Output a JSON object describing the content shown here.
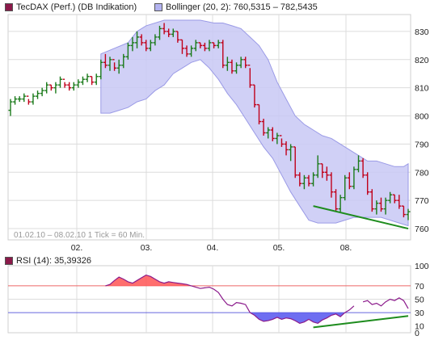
{
  "legend": {
    "main": {
      "label": "TecDAX (Perf.) (DB Indikation)",
      "color": "#8b1a4a"
    },
    "bollinger": {
      "label": "Bollinger (20, 2): 760,5315 – 782,5435",
      "color": "#b3b3f0"
    },
    "rsi": {
      "label": "RSI (14): 35,39326",
      "color": "#8b1a4a"
    }
  },
  "info": "01.02.10 – 08.02.10   1 Tick = 60 Min.",
  "colors": {
    "up": "#1a7a1a",
    "down": "#c0001a",
    "band_fill": "#c8c8f4",
    "band_stroke": "#9a9ae6",
    "trend": "#1e8c1e",
    "rsi_line": "#8b1a8b",
    "rsi_over": "#ff5555",
    "rsi_under": "#5555ee",
    "grid": "#dcdcdc",
    "line70": "#ee6666",
    "line30": "#6666dd"
  },
  "chart_data": [
    {
      "type": "candlestick",
      "title": "TecDAX (Perf.) (DB Indikation)",
      "x_ticks": [
        "02.",
        "03.",
        "04.",
        "05.",
        "08."
      ],
      "ylim": [
        756,
        836
      ],
      "y_ticks": [
        760,
        770,
        780,
        790,
        800,
        810,
        820,
        830
      ],
      "bars_ohlc": [
        [
          802,
          806,
          800,
          805
        ],
        [
          805,
          807,
          804,
          806
        ],
        [
          806,
          807,
          805,
          806
        ],
        [
          806,
          808,
          805,
          807
        ],
        [
          807,
          806,
          804,
          805
        ],
        [
          805,
          808,
          804,
          807
        ],
        [
          807,
          809,
          806,
          808
        ],
        [
          808,
          810,
          807,
          809
        ],
        [
          809,
          812,
          808,
          811
        ],
        [
          811,
          811,
          809,
          810
        ],
        [
          810,
          812,
          808,
          811
        ],
        [
          811,
          814,
          810,
          813
        ],
        [
          813,
          812,
          810,
          811
        ],
        [
          811,
          812,
          809,
          810
        ],
        [
          810,
          812,
          809,
          811
        ],
        [
          811,
          813,
          810,
          812
        ],
        [
          812,
          814,
          811,
          813
        ],
        [
          813,
          815,
          812,
          814
        ],
        [
          814,
          814,
          811,
          812
        ],
        [
          812,
          815,
          811,
          814
        ],
        [
          814,
          820,
          813,
          819
        ],
        [
          819,
          822,
          817,
          818
        ],
        [
          818,
          821,
          816,
          820
        ],
        [
          820,
          819,
          816,
          817
        ],
        [
          817,
          820,
          815,
          818
        ],
        [
          818,
          822,
          817,
          821
        ],
        [
          821,
          826,
          820,
          825
        ],
        [
          825,
          828,
          823,
          826
        ],
        [
          826,
          830,
          824,
          828
        ],
        [
          828,
          829,
          825,
          826
        ],
        [
          826,
          827,
          823,
          824
        ],
        [
          824,
          827,
          823,
          826
        ],
        [
          826,
          829,
          825,
          828
        ],
        [
          828,
          832,
          827,
          831
        ],
        [
          831,
          833,
          829,
          830
        ],
        [
          830,
          831,
          828,
          829
        ],
        [
          829,
          831,
          828,
          830
        ],
        [
          830,
          830,
          826,
          827
        ],
        [
          827,
          827,
          822,
          824
        ],
        [
          824,
          825,
          821,
          822
        ],
        [
          822,
          825,
          821,
          824
        ],
        [
          824,
          827,
          823,
          826
        ],
        [
          826,
          826,
          824,
          825
        ],
        [
          825,
          826,
          823,
          824
        ],
        [
          824,
          827,
          823,
          826
        ],
        [
          826,
          826,
          824,
          825
        ],
        [
          825,
          827,
          824,
          826
        ],
        [
          826,
          827,
          817,
          818
        ],
        [
          818,
          821,
          816,
          819
        ],
        [
          819,
          820,
          815,
          816
        ],
        [
          816,
          819,
          815,
          818
        ],
        [
          818,
          821,
          817,
          820
        ],
        [
          820,
          821,
          817,
          818
        ],
        [
          818,
          817,
          810,
          811
        ],
        [
          811,
          811,
          803,
          804
        ],
        [
          804,
          804,
          797,
          798
        ],
        [
          798,
          799,
          793,
          794
        ],
        [
          794,
          796,
          792,
          795
        ],
        [
          795,
          796,
          791,
          792
        ],
        [
          792,
          794,
          790,
          793
        ],
        [
          793,
          792,
          789,
          790
        ],
        [
          790,
          791,
          786,
          788
        ],
        [
          788,
          790,
          784,
          789
        ],
        [
          789,
          789,
          778,
          779
        ],
        [
          779,
          780,
          775,
          776
        ],
        [
          776,
          779,
          774,
          778
        ],
        [
          778,
          779,
          775,
          776
        ],
        [
          776,
          780,
          775,
          779
        ],
        [
          779,
          786,
          778,
          783
        ],
        [
          783,
          783,
          778,
          780
        ],
        [
          780,
          782,
          777,
          779
        ],
        [
          779,
          780,
          771,
          773
        ],
        [
          773,
          774,
          766,
          767
        ],
        [
          767,
          772,
          766,
          771
        ],
        [
          771,
          779,
          770,
          778
        ],
        [
          778,
          780,
          774,
          775
        ],
        [
          775,
          782,
          774,
          781
        ],
        [
          781,
          786,
          780,
          784
        ],
        [
          784,
          785,
          778,
          779
        ],
        [
          779,
          780,
          772,
          773
        ],
        [
          773,
          774,
          766,
          767
        ],
        [
          767,
          770,
          765,
          769
        ],
        [
          769,
          771,
          766,
          767
        ],
        [
          767,
          771,
          765,
          770
        ],
        [
          770,
          773,
          769,
          772
        ],
        [
          772,
          772,
          769,
          770
        ],
        [
          770,
          772,
          767,
          768
        ],
        [
          768,
          768,
          764,
          765
        ],
        [
          765,
          767,
          763,
          766
        ]
      ],
      "bollinger_upper": [
        [
          20,
          822
        ],
        [
          23,
          824
        ],
        [
          26,
          826
        ],
        [
          28,
          830
        ],
        [
          30,
          832
        ],
        [
          34,
          834
        ],
        [
          38,
          834
        ],
        [
          42,
          834
        ],
        [
          45,
          833
        ],
        [
          47,
          833
        ],
        [
          49,
          832
        ],
        [
          51,
          831
        ],
        [
          53,
          828
        ],
        [
          55,
          825
        ],
        [
          57,
          820
        ],
        [
          59,
          812
        ],
        [
          61,
          806
        ],
        [
          63,
          800
        ],
        [
          65,
          797
        ],
        [
          67,
          795
        ],
        [
          69,
          793
        ],
        [
          71,
          792
        ],
        [
          73,
          790
        ],
        [
          75,
          788
        ],
        [
          77,
          786
        ],
        [
          79,
          784
        ],
        [
          81,
          784
        ],
        [
          83,
          783
        ],
        [
          85,
          782
        ],
        [
          87,
          782
        ],
        [
          88,
          783
        ]
      ],
      "bollinger_lower": [
        [
          20,
          801
        ],
        [
          22,
          801
        ],
        [
          24,
          802
        ],
        [
          26,
          803
        ],
        [
          28,
          805
        ],
        [
          30,
          806
        ],
        [
          32,
          809
        ],
        [
          34,
          811
        ],
        [
          36,
          815
        ],
        [
          38,
          817
        ],
        [
          40,
          819
        ],
        [
          42,
          820
        ],
        [
          44,
          817
        ],
        [
          46,
          813
        ],
        [
          48,
          808
        ],
        [
          50,
          804
        ],
        [
          52,
          799
        ],
        [
          54,
          794
        ],
        [
          56,
          789
        ],
        [
          58,
          785
        ],
        [
          60,
          779
        ],
        [
          62,
          773
        ],
        [
          64,
          768
        ],
        [
          66,
          763
        ],
        [
          68,
          762
        ],
        [
          70,
          762
        ],
        [
          72,
          762
        ],
        [
          74,
          763
        ],
        [
          76,
          764
        ],
        [
          78,
          764
        ],
        [
          80,
          764
        ],
        [
          82,
          764
        ],
        [
          84,
          763
        ],
        [
          86,
          762
        ],
        [
          88,
          761
        ]
      ],
      "trendline": [
        [
          67,
          768
        ],
        [
          88,
          760
        ]
      ]
    },
    {
      "type": "line",
      "title": "RSI (14)",
      "ylim": [
        0,
        100
      ],
      "y_ticks": [
        0,
        10,
        30,
        50,
        70,
        100
      ],
      "reference_lines": [
        70,
        30
      ],
      "rsi": [
        [
          21,
          70
        ],
        [
          22,
          72
        ],
        [
          23,
          78
        ],
        [
          24,
          83
        ],
        [
          25,
          80
        ],
        [
          26,
          76
        ],
        [
          27,
          74
        ],
        [
          28,
          78
        ],
        [
          29,
          82
        ],
        [
          30,
          86
        ],
        [
          31,
          84
        ],
        [
          32,
          80
        ],
        [
          33,
          76
        ],
        [
          34,
          74
        ],
        [
          35,
          76
        ],
        [
          36,
          75
        ],
        [
          37,
          74
        ],
        [
          38,
          73
        ],
        [
          39,
          72
        ],
        [
          40,
          70
        ],
        [
          41,
          68
        ],
        [
          42,
          66
        ],
        [
          43,
          67
        ],
        [
          44,
          68
        ],
        [
          45,
          65
        ],
        [
          46,
          60
        ],
        [
          47,
          50
        ],
        [
          48,
          42
        ],
        [
          49,
          40
        ],
        [
          50,
          45
        ],
        [
          51,
          44
        ],
        [
          52,
          42
        ],
        [
          53,
          30
        ],
        [
          54,
          26
        ],
        [
          55,
          20
        ],
        [
          56,
          17
        ],
        [
          57,
          18
        ],
        [
          58,
          20
        ],
        [
          59,
          23
        ],
        [
          60,
          20
        ],
        [
          61,
          22
        ],
        [
          62,
          21
        ],
        [
          63,
          18
        ],
        [
          64,
          14
        ],
        [
          65,
          16
        ],
        [
          66,
          20
        ],
        [
          67,
          16
        ],
        [
          68,
          14
        ],
        [
          69,
          19
        ],
        [
          70,
          22
        ],
        [
          71,
          26
        ],
        [
          72,
          28
        ],
        [
          73,
          24
        ],
        [
          74,
          30
        ],
        [
          75,
          34
        ],
        [
          76,
          40
        ],
        [
          78,
          46
        ],
        [
          79,
          48
        ],
        [
          80,
          42
        ],
        [
          81,
          44
        ],
        [
          82,
          40
        ],
        [
          83,
          46
        ],
        [
          84,
          50
        ],
        [
          85,
          48
        ],
        [
          86,
          52
        ],
        [
          87,
          48
        ],
        [
          88,
          36
        ]
      ],
      "trendline": [
        [
          67,
          8
        ],
        [
          88,
          25
        ]
      ]
    }
  ]
}
